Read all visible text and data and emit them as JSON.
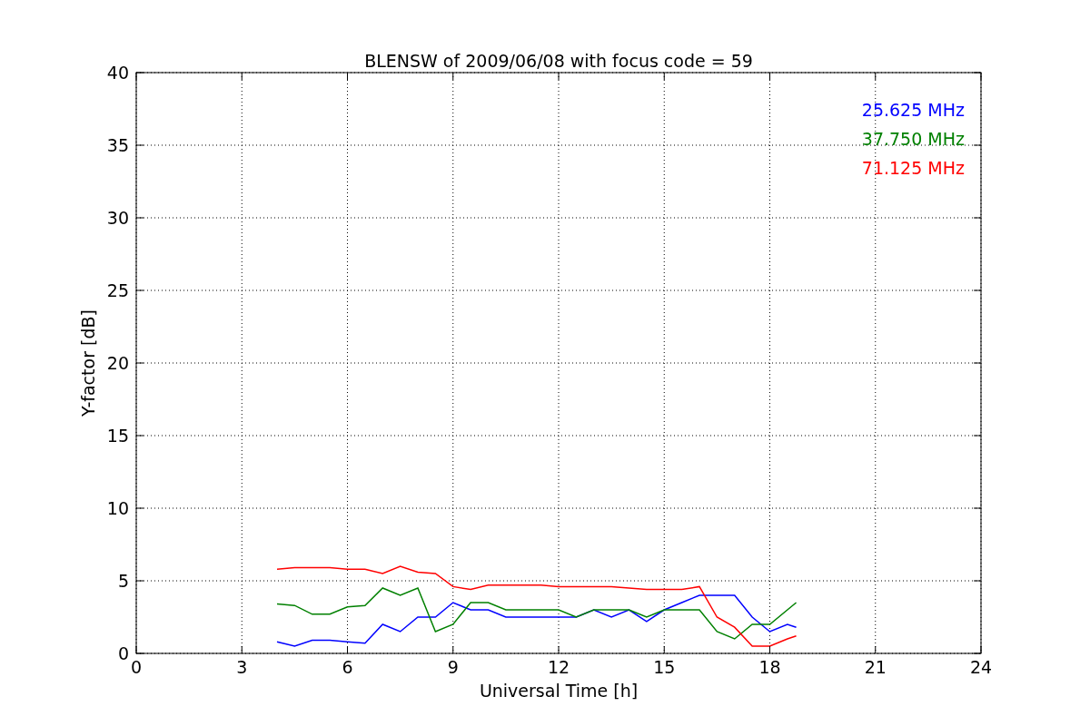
{
  "chart_data": {
    "type": "line",
    "title": "BLENSW of 2009/06/08 with focus code = 59",
    "xlabel": "Universal Time [h]",
    "ylabel": "Y-factor [dB]",
    "x": [
      4,
      4.5,
      5,
      5.5,
      6,
      6.5,
      7,
      7.5,
      8,
      8.5,
      9,
      9.5,
      10,
      10.5,
      11,
      11.5,
      12,
      12.5,
      13,
      13.5,
      14,
      14.5,
      15,
      15.5,
      16,
      16.5,
      17,
      17.5,
      18,
      18.5,
      18.75
    ],
    "series": [
      {
        "name": "25.625 MHz",
        "color": "#0000ff",
        "values": [
          0.8,
          0.5,
          0.9,
          0.9,
          0.8,
          0.7,
          2.0,
          1.5,
          2.5,
          2.5,
          3.5,
          3,
          3,
          2.5,
          2.5,
          2.5,
          2.5,
          2.5,
          3,
          2.5,
          3,
          2.2,
          3,
          3.5,
          4,
          4,
          4,
          2.5,
          1.5,
          2,
          1.8
        ]
      },
      {
        "name": "37.750 MHz",
        "color": "#008000",
        "values": [
          3.4,
          3.3,
          2.7,
          2.7,
          3.2,
          3.3,
          4.5,
          4,
          4.5,
          1.5,
          2,
          3.5,
          3.5,
          3,
          3,
          3,
          3,
          2.5,
          3,
          3,
          3,
          2.5,
          3,
          3,
          3,
          1.5,
          1,
          2,
          2,
          3,
          3.5
        ]
      },
      {
        "name": "71.125 MHz",
        "color": "#ff0000",
        "values": [
          5.8,
          5.9,
          5.9,
          5.9,
          5.8,
          5.8,
          5.5,
          6,
          5.6,
          5.5,
          4.6,
          4.4,
          4.7,
          4.7,
          4.7,
          4.7,
          4.6,
          4.6,
          4.6,
          4.6,
          4.5,
          4.4,
          4.4,
          4.4,
          4.6,
          2.5,
          1.8,
          0.5,
          0.5,
          1,
          1.2
        ]
      }
    ],
    "grid": true,
    "xlim": [
      0,
      24
    ],
    "ylim": [
      0,
      40
    ],
    "xticks": [
      0,
      3,
      6,
      9,
      12,
      15,
      18,
      21,
      24
    ],
    "yticks": [
      0,
      5,
      10,
      15,
      20,
      25,
      30,
      35,
      40
    ]
  }
}
